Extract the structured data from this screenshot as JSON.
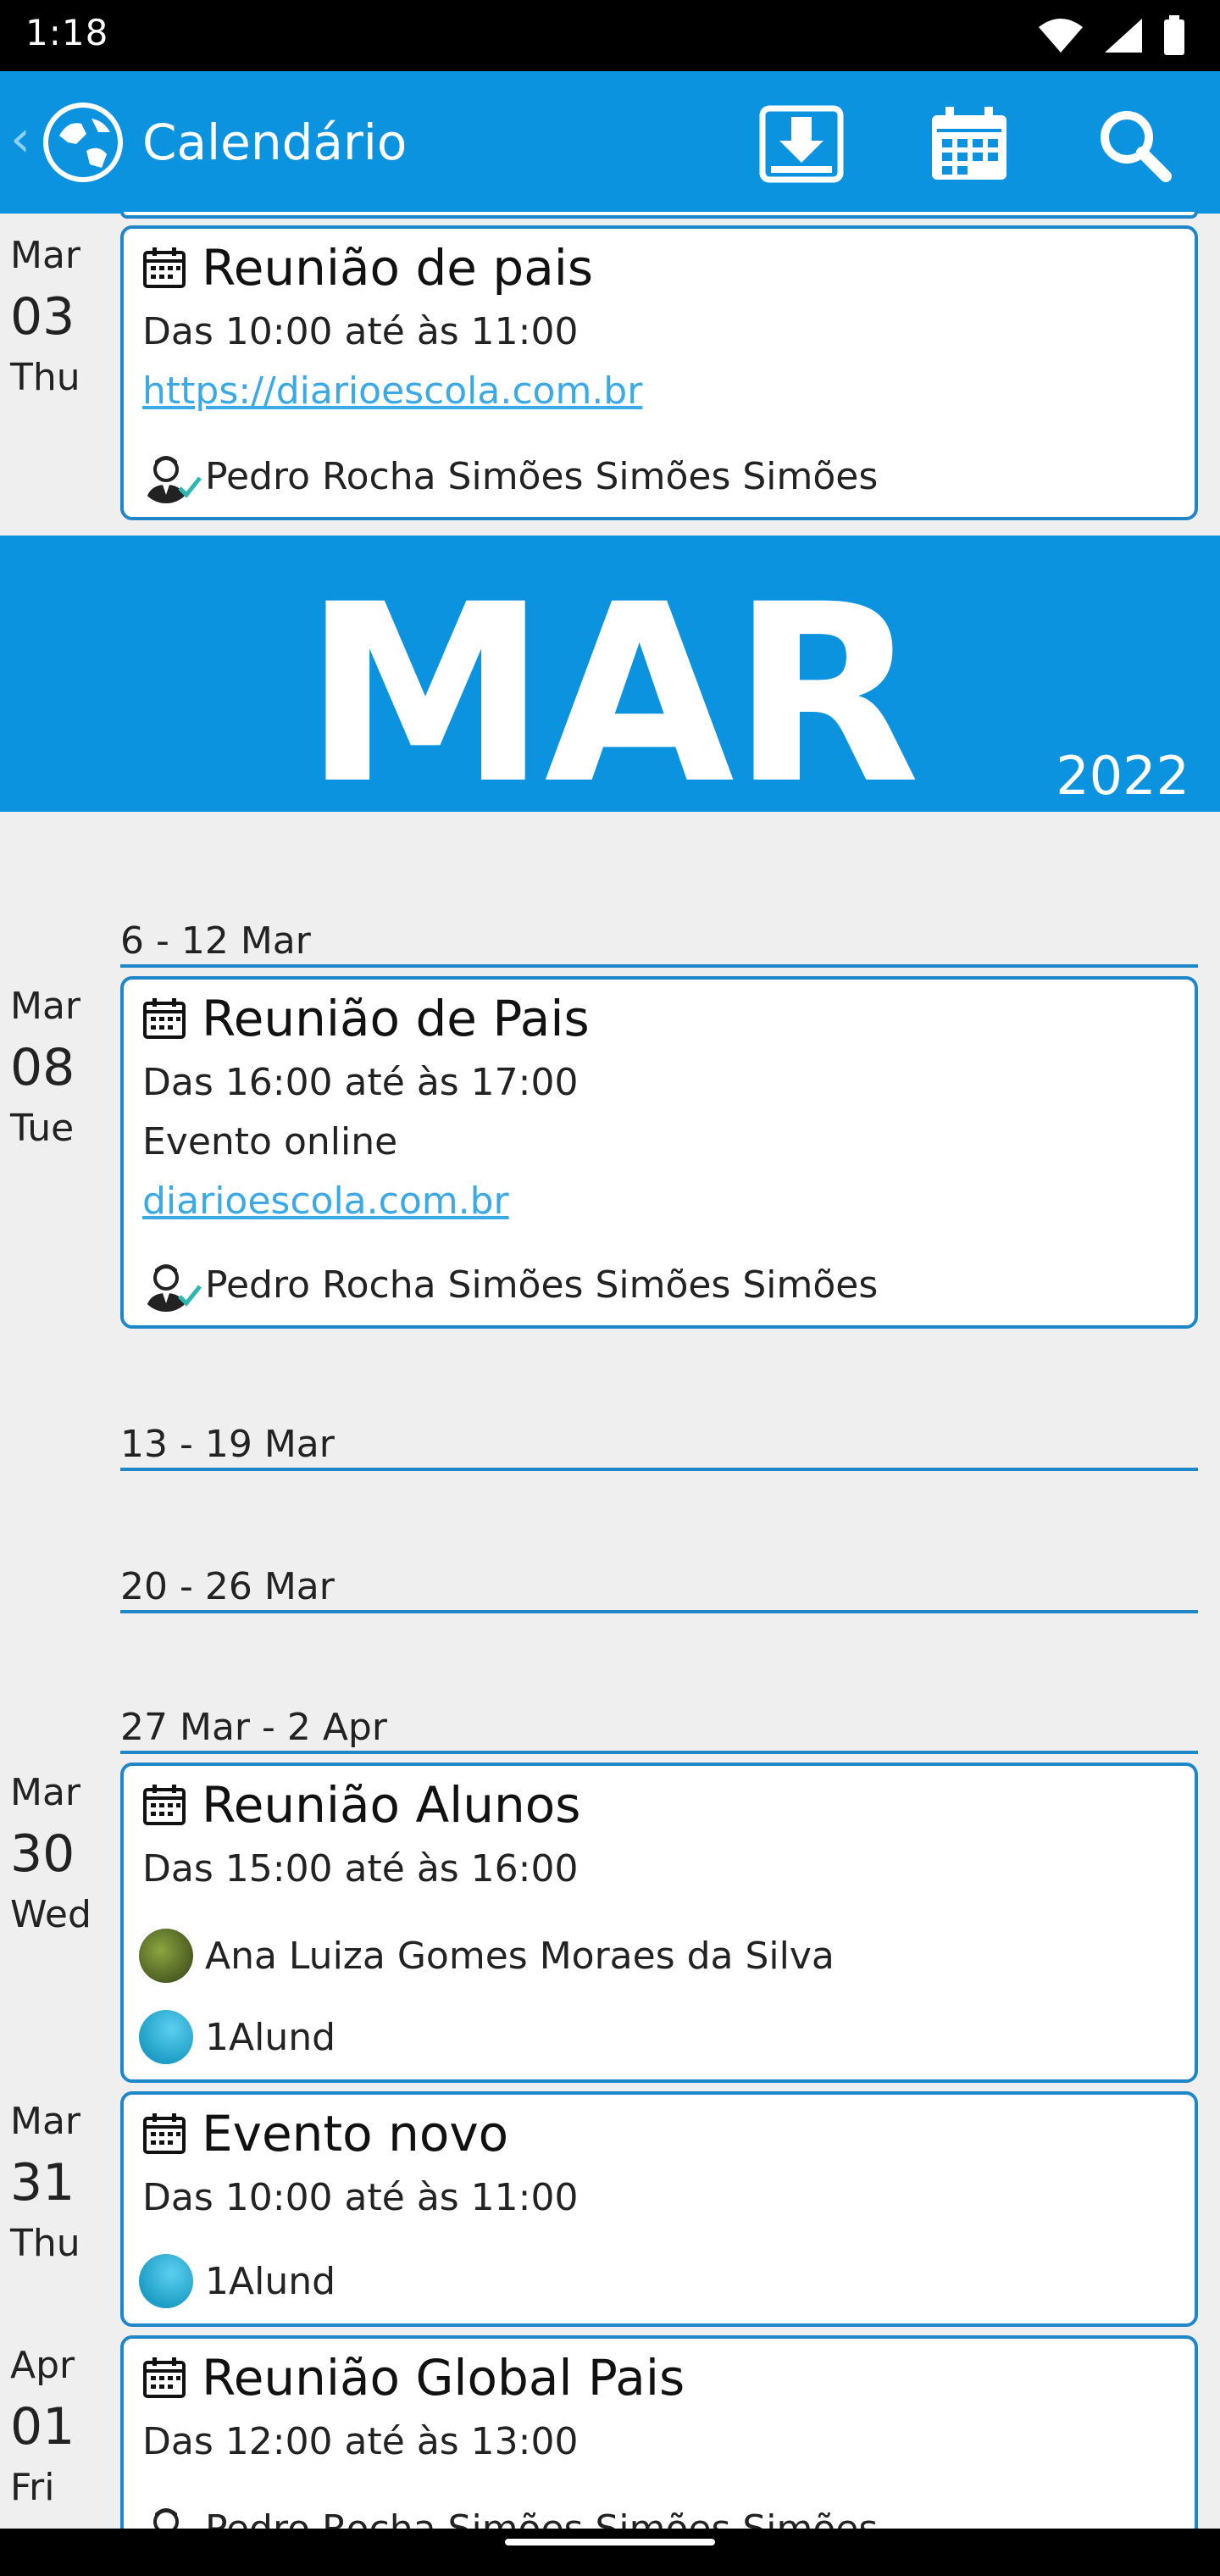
{
  "status": {
    "time": "1:18"
  },
  "appbar": {
    "title": "Calendário"
  },
  "colors": {
    "primary": "#0b93e0",
    "border": "#1f86c9",
    "link": "#3ba9e6"
  },
  "banner": {
    "month": "MAR",
    "year": "2022"
  },
  "weeks": [
    "6 - 12 Mar",
    "13 - 19 Mar",
    "20 - 26 Mar",
    "27 Mar - 2 Apr"
  ],
  "events": [
    {
      "month": "Mar",
      "day": "03",
      "weekday": "Thu",
      "title": "Reunião de pais",
      "time": "Das 10:00 até às 11:00",
      "link": "https://diarioescola.com.br",
      "participants": [
        "Pedro Rocha Simões Simões Simões"
      ]
    },
    {
      "month": "Mar",
      "day": "08",
      "weekday": "Tue",
      "title": "Reunião de Pais",
      "time": "Das 16:00 até às 17:00",
      "note": "Evento online",
      "link": "diarioescola.com.br",
      "participants": [
        "Pedro Rocha Simões Simões Simões"
      ]
    },
    {
      "month": "Mar",
      "day": "30",
      "weekday": "Wed",
      "title": "Reunião Alunos",
      "time": "Das 15:00 até às 16:00",
      "participants": [
        "Ana Luiza Gomes Moraes da Silva",
        "1Alund"
      ]
    },
    {
      "month": "Mar",
      "day": "31",
      "weekday": "Thu",
      "title": "Evento novo",
      "time": "Das 10:00 até às 11:00",
      "participants": [
        "1Alund"
      ]
    },
    {
      "month": "Apr",
      "day": "01",
      "weekday": "Fri",
      "title": "Reunião Global Pais",
      "time": "Das 12:00 até às 13:00",
      "participants": [
        "Pedro Rocha Simões Simões Simões"
      ]
    }
  ]
}
